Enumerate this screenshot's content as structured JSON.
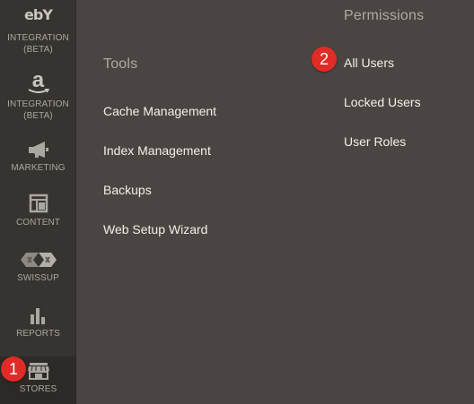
{
  "sidebar": {
    "items": [
      {
        "key": "ebay",
        "logo_text": "ebY",
        "label": "INTEGRATION\n(BETA)",
        "icon": "ebay-logo-icon"
      },
      {
        "key": "amazon",
        "logo_text": "a",
        "label": "INTEGRATION\n(BETA)",
        "icon": "amazon-logo-icon"
      },
      {
        "key": "marketing",
        "label": "MARKETING",
        "icon": "megaphone-icon"
      },
      {
        "key": "content",
        "label": "CONTENT",
        "icon": "layout-icon"
      },
      {
        "key": "swissup",
        "label": "SWISSUP",
        "icon": "swissup-logo-icon"
      },
      {
        "key": "reports",
        "label": "REPORTS",
        "icon": "bar-chart-icon"
      },
      {
        "key": "stores",
        "label": "STORES",
        "icon": "store-icon"
      }
    ]
  },
  "submenu": {
    "tools": {
      "title": "Tools",
      "items": [
        "Cache Management",
        "Index Management",
        "Backups",
        "Web Setup Wizard"
      ]
    },
    "permissions": {
      "title": "Permissions",
      "items": [
        "All Users",
        "Locked Users",
        "User Roles"
      ]
    }
  },
  "annotations": {
    "step1": "1",
    "step2": "2"
  },
  "colors": {
    "sidebar_bg": "#373330",
    "panel_bg": "#4a4542",
    "badge": "#e02b27",
    "link_text": "#f2f0ec",
    "heading_text": "#adaaa5"
  }
}
